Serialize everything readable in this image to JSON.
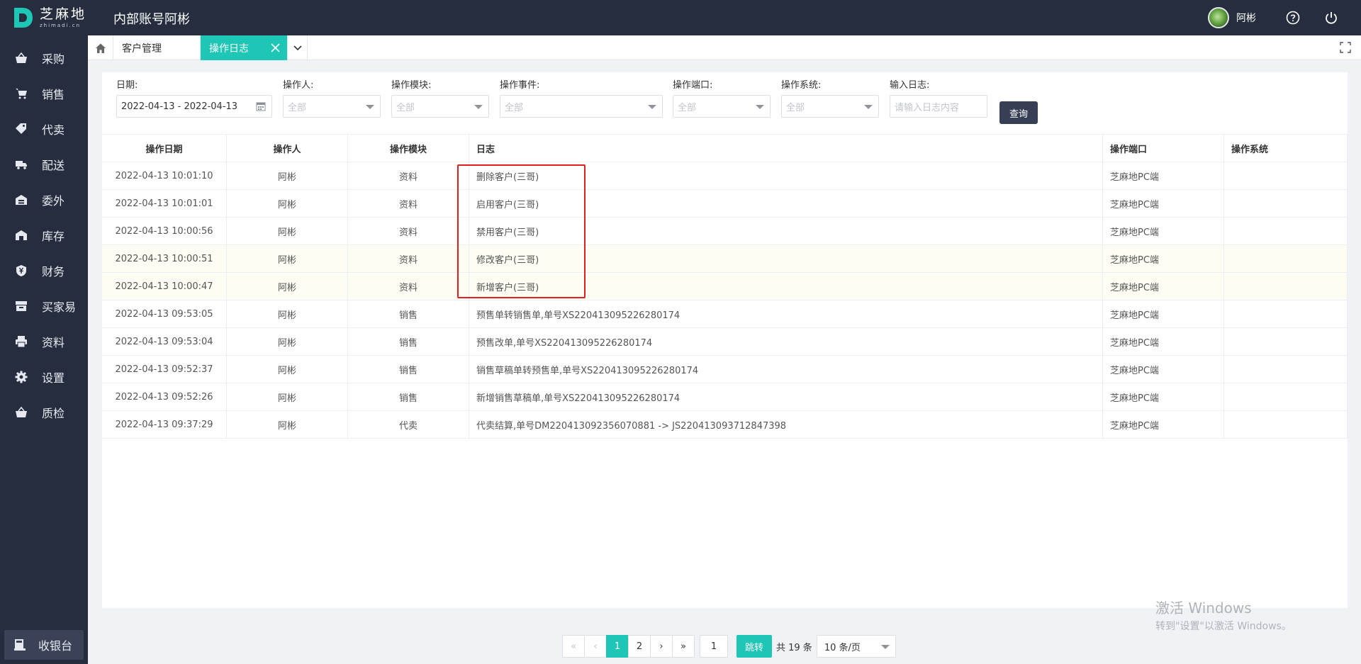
{
  "app": {
    "logo_cn": "芝麻地",
    "logo_en": "zhimadi.cn",
    "title": "内部账号阿彬",
    "user_name": "阿彬",
    "brand_color": "#1ec6b6",
    "nav_bg": "#252d3e"
  },
  "icons": {
    "help": "help-circle-icon",
    "power": "power-icon",
    "home": "home-icon",
    "fullscreen": "fullscreen-icon"
  },
  "sidebar": {
    "items": [
      {
        "label": "采购",
        "icon": "basket-icon"
      },
      {
        "label": "销售",
        "icon": "cart-icon"
      },
      {
        "label": "代卖",
        "icon": "tag-icon"
      },
      {
        "label": "配送",
        "icon": "truck-icon"
      },
      {
        "label": "委外",
        "icon": "warehouse-icon"
      },
      {
        "label": "库存",
        "icon": "storehouse-icon"
      },
      {
        "label": "财务",
        "icon": "yen-shield-icon"
      },
      {
        "label": "买家易",
        "icon": "shop-icon"
      },
      {
        "label": "资料",
        "icon": "printer-icon"
      },
      {
        "label": "设置",
        "icon": "gear-icon"
      },
      {
        "label": "质检",
        "icon": "basket-icon"
      }
    ],
    "cashier_label": "收银台"
  },
  "tabs": [
    {
      "label": "客户管理"
    },
    {
      "label": "操作日志"
    }
  ],
  "filters": {
    "date": {
      "label": "日期:",
      "value": "2022-04-13 - 2022-04-13"
    },
    "operator": {
      "label": "操作人:",
      "value": "全部"
    },
    "module": {
      "label": "操作模块:",
      "value": "全部"
    },
    "event": {
      "label": "操作事件:",
      "value": "全部"
    },
    "port": {
      "label": "操作端口:",
      "value": "全部"
    },
    "system": {
      "label": "操作系统:",
      "value": "全部"
    },
    "log": {
      "label": "输入日志:",
      "placeholder": "请输入日志内容"
    },
    "query_label": "查询"
  },
  "table": {
    "headers": [
      "操作日期",
      "操作人",
      "操作模块",
      "日志",
      "操作端口",
      "操作系统"
    ],
    "rows": [
      {
        "date": "2022-04-13 10:01:10",
        "operator": "阿彬",
        "module": "资料",
        "log": "删除客户(三哥)",
        "port": "芝麻地PC端",
        "system": ""
      },
      {
        "date": "2022-04-13 10:01:01",
        "operator": "阿彬",
        "module": "资料",
        "log": "启用客户(三哥)",
        "port": "芝麻地PC端",
        "system": ""
      },
      {
        "date": "2022-04-13 10:00:56",
        "operator": "阿彬",
        "module": "资料",
        "log": "禁用客户(三哥)",
        "port": "芝麻地PC端",
        "system": ""
      },
      {
        "date": "2022-04-13 10:00:51",
        "operator": "阿彬",
        "module": "资料",
        "log": "修改客户(三哥)",
        "port": "芝麻地PC端",
        "system": ""
      },
      {
        "date": "2022-04-13 10:00:47",
        "operator": "阿彬",
        "module": "资料",
        "log": "新增客户(三哥)",
        "port": "芝麻地PC端",
        "system": ""
      },
      {
        "date": "2022-04-13 09:53:05",
        "operator": "阿彬",
        "module": "销售",
        "log": "预售单转销售单,单号XS220413095226280174",
        "port": "芝麻地PC端",
        "system": ""
      },
      {
        "date": "2022-04-13 09:53:04",
        "operator": "阿彬",
        "module": "销售",
        "log": "预售改单,单号XS220413095226280174",
        "port": "芝麻地PC端",
        "system": ""
      },
      {
        "date": "2022-04-13 09:52:37",
        "operator": "阿彬",
        "module": "销售",
        "log": "销售草稿单转预售单,单号XS220413095226280174",
        "port": "芝麻地PC端",
        "system": ""
      },
      {
        "date": "2022-04-13 09:52:26",
        "operator": "阿彬",
        "module": "销售",
        "log": "新增销售草稿单,单号XS220413095226280174",
        "port": "芝麻地PC端",
        "system": ""
      },
      {
        "date": "2022-04-13 09:37:29",
        "operator": "阿彬",
        "module": "代卖",
        "log": "代卖结算,单号DM220413092356070881 -> JS220413093712847398",
        "port": "芝麻地PC端",
        "system": ""
      }
    ]
  },
  "pagination": {
    "pages": [
      "1",
      "2"
    ],
    "current": "1",
    "jump_value": "1",
    "go_label": "跳转",
    "total_label": "共 19 条",
    "page_size": "10 条/页"
  },
  "watermark": {
    "line1": "激活 Windows",
    "line2": "转到\"设置\"以激活 Windows。"
  }
}
